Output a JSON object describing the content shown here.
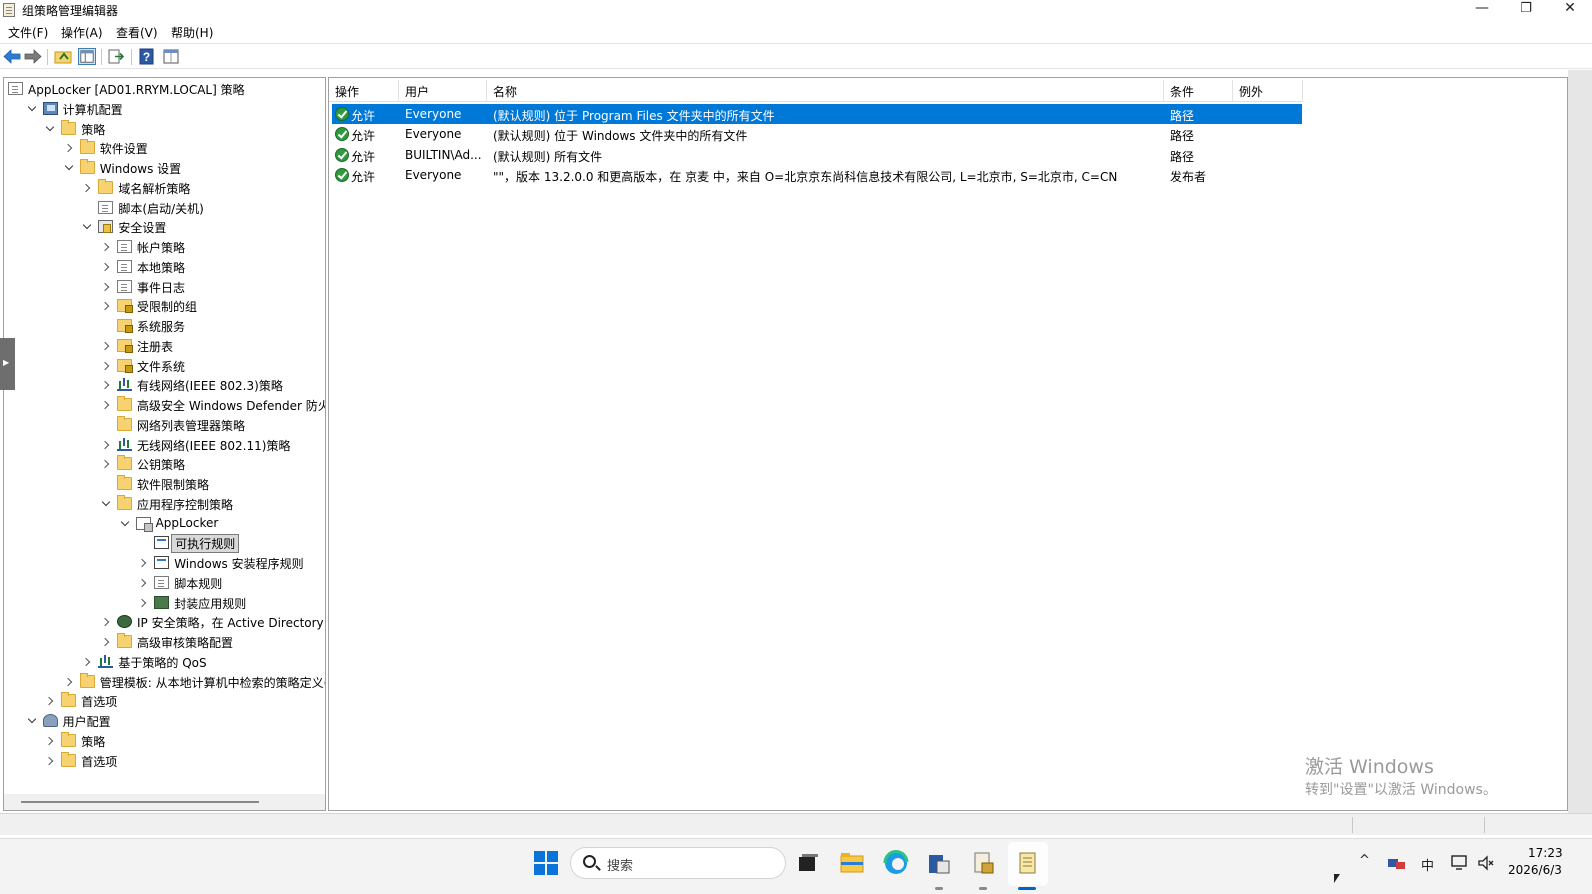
{
  "window": {
    "title": "组策略管理编辑器",
    "min_glyph": "—",
    "max_glyph": "❐",
    "close_glyph": "✕"
  },
  "menu": [
    "文件(F)",
    "操作(A)",
    "查看(V)",
    "帮助(H)"
  ],
  "toolbar": {
    "back_icon": "back-arrow-icon",
    "forward_icon": "forward-arrow-icon",
    "help_glyph": "?"
  },
  "tree": [
    {
      "label": "AppLocker [AD01.RRYM.LOCAL] 策略",
      "icon": "doc"
    },
    {
      "label": "计算机配置",
      "icon": "computer",
      "state": "expanded"
    },
    {
      "label": "策略",
      "icon": "folder",
      "state": "expanded"
    },
    {
      "label": "软件设置",
      "icon": "folder",
      "state": "collapsed"
    },
    {
      "label": "Windows 设置",
      "icon": "folder",
      "state": "expanded"
    },
    {
      "label": "域名解析策略",
      "icon": "folder",
      "state": "collapsed"
    },
    {
      "label": "脚本(启动/关机)",
      "icon": "doc"
    },
    {
      "label": "安全设置",
      "icon": "shield-doc",
      "state": "expanded"
    },
    {
      "label": "帐户策略",
      "icon": "doc",
      "state": "collapsed"
    },
    {
      "label": "本地策略",
      "icon": "doc",
      "state": "collapsed"
    },
    {
      "label": "事件日志",
      "icon": "doc",
      "state": "collapsed"
    },
    {
      "label": "受限制的组",
      "icon": "folder-lock",
      "state": "collapsed"
    },
    {
      "label": "系统服务",
      "icon": "folder-lock"
    },
    {
      "label": "注册表",
      "icon": "folder-lock",
      "state": "collapsed"
    },
    {
      "label": "文件系统",
      "icon": "folder-lock",
      "state": "collapsed"
    },
    {
      "label": "有线网络(IEEE 802.3)策略",
      "icon": "chart",
      "state": "collapsed"
    },
    {
      "label": "高级安全 Windows Defender 防火墙",
      "icon": "folder",
      "state": "collapsed"
    },
    {
      "label": "网络列表管理器策略",
      "icon": "folder"
    },
    {
      "label": "无线网络(IEEE 802.11)策略",
      "icon": "chart",
      "state": "collapsed"
    },
    {
      "label": "公钥策略",
      "icon": "folder",
      "state": "collapsed"
    },
    {
      "label": "软件限制策略",
      "icon": "folder"
    },
    {
      "label": "应用程序控制策略",
      "icon": "folder",
      "state": "expanded"
    },
    {
      "label": "AppLocker",
      "icon": "applocker",
      "state": "expanded"
    },
    {
      "label": "可执行规则",
      "icon": "rule",
      "selected": true
    },
    {
      "label": "Windows 安装程序规则",
      "icon": "rule",
      "state": "collapsed"
    },
    {
      "label": "脚本规则",
      "icon": "doc",
      "state": "collapsed"
    },
    {
      "label": "封装应用规则",
      "icon": "package",
      "state": "collapsed"
    },
    {
      "label": "IP 安全策略，在 Active Directory (RR",
      "icon": "ipsec",
      "state": "collapsed"
    },
    {
      "label": "高级审核策略配置",
      "icon": "folder",
      "state": "collapsed"
    },
    {
      "label": "基于策略的 QoS",
      "icon": "chart",
      "state": "collapsed"
    },
    {
      "label": "管理模板: 从本地计算机中检索的策略定义(AD",
      "icon": "folder",
      "state": "collapsed"
    },
    {
      "label": "首选项",
      "icon": "folder",
      "state": "collapsed"
    },
    {
      "label": "用户配置",
      "icon": "users",
      "state": "expanded"
    },
    {
      "label": "策略",
      "icon": "folder",
      "state": "collapsed"
    },
    {
      "label": "首选项",
      "icon": "folder",
      "state": "collapsed"
    }
  ],
  "list": {
    "columns": [
      "操作",
      "用户",
      "名称",
      "条件",
      "例外"
    ],
    "rows": [
      {
        "action": "允许",
        "user": "Everyone",
        "name": "(默认规则) 位于 Program Files 文件夹中的所有文件",
        "condition": "路径",
        "exception": ""
      },
      {
        "action": "允许",
        "user": "Everyone",
        "name": "(默认规则) 位于 Windows 文件夹中的所有文件",
        "condition": "路径",
        "exception": ""
      },
      {
        "action": "允许",
        "user": "BUILTIN\\Ad...",
        "name": "(默认规则) 所有文件",
        "condition": "路径",
        "exception": ""
      },
      {
        "action": "允许",
        "user": "Everyone",
        "name": "\"\"，版本 13.2.0.0 和更高版本，在 京麦 中，来自 O=北京京东尚科信息技术有限公司, L=北京市, S=北京市, C=CN",
        "condition": "发布者",
        "exception": ""
      }
    ]
  },
  "watermark": {
    "title": "激活 Windows",
    "subtitle": "转到\"设置\"以激活 Windows。"
  },
  "taskbar": {
    "search_placeholder": "搜索",
    "ime": "中",
    "chevron": "^",
    "time": "17:23",
    "date": "2026/6/3"
  },
  "colors": {
    "selection": "#0078d7",
    "accent": "#0067c0",
    "watermark": "#9a9a9a"
  }
}
